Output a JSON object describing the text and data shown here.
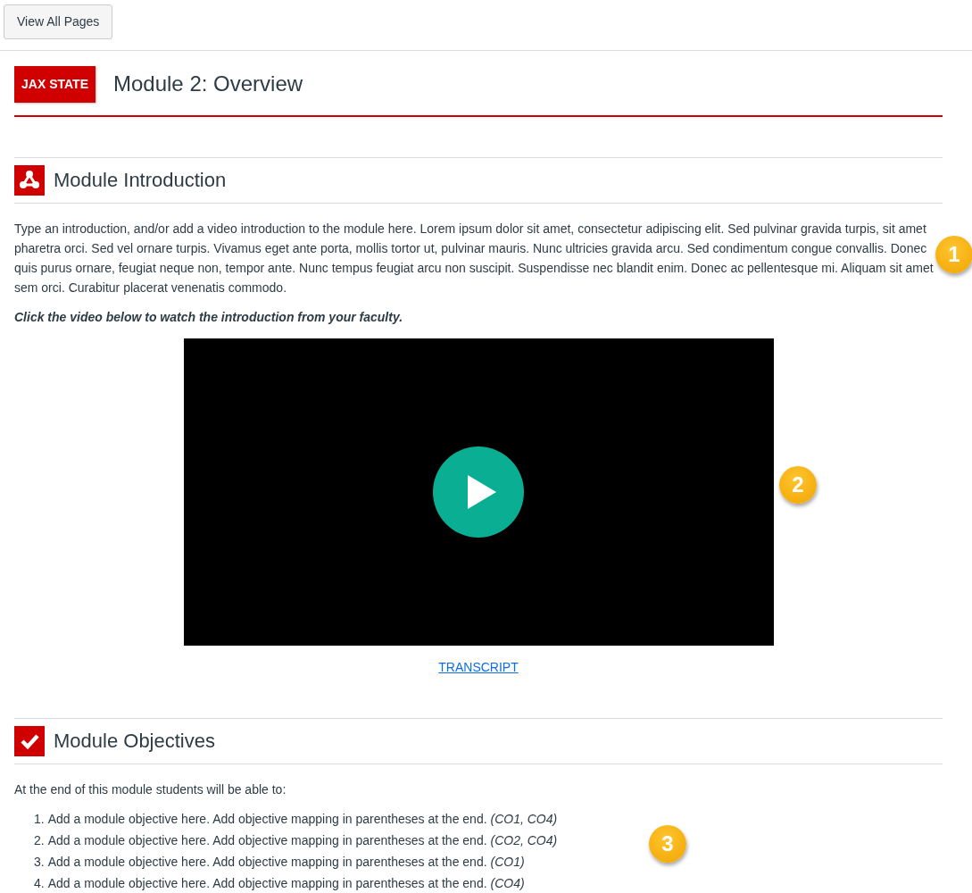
{
  "top_button": "View All Pages",
  "header": {
    "logo": "JAX STATE",
    "title": "Module 2: Overview"
  },
  "introduction": {
    "title": "Module Introduction",
    "text": "Type an introduction, and/or add a video introduction to the module here. Lorem ipsum dolor sit amet, consectetur adipiscing elit. Sed pulvinar gravida turpis, sit amet pharetra orci. Sed vel ornare turpis. Vivamus eget ante porta, mollis tortor ut, pulvinar mauris. Nunc ultricies gravida arcu. Sed condimentum congue convallis. Donec quis purus ornare, feugiat neque non, tempor ante. Nunc tempus feugiat arcu non suscipit. Suspendisse nec blandit enim. Donec ac pellentesque mi. Aliquam sit amet sem orci. Curabitur placerat venenatis commodo.",
    "prompt": "Click the video below to watch the introduction from your faculty.",
    "transcript_link": "TRANSCRIPT"
  },
  "objectives": {
    "title": "Module Objectives",
    "lead": "At the end of this module students will be able to:",
    "items": [
      {
        "number": "1.",
        "text": "Add a module objective here. Add objective mapping in parentheses at the end. *(CO1, CO4)*"
      },
      {
        "number": "2.",
        "text": "Add a module objective here. Add objective mapping in parentheses at the end. *(CO2, CO4)*"
      },
      {
        "number": "3.",
        "text": "Add a module objective here. Add objective mapping in parentheses at the end. *(CO1)*"
      },
      {
        "number": "4.",
        "text": "Add a module objective here. Add objective mapping in parentheses at the end. *(CO4)*"
      }
    ]
  },
  "callouts": [
    "1",
    "2",
    "3"
  ]
}
